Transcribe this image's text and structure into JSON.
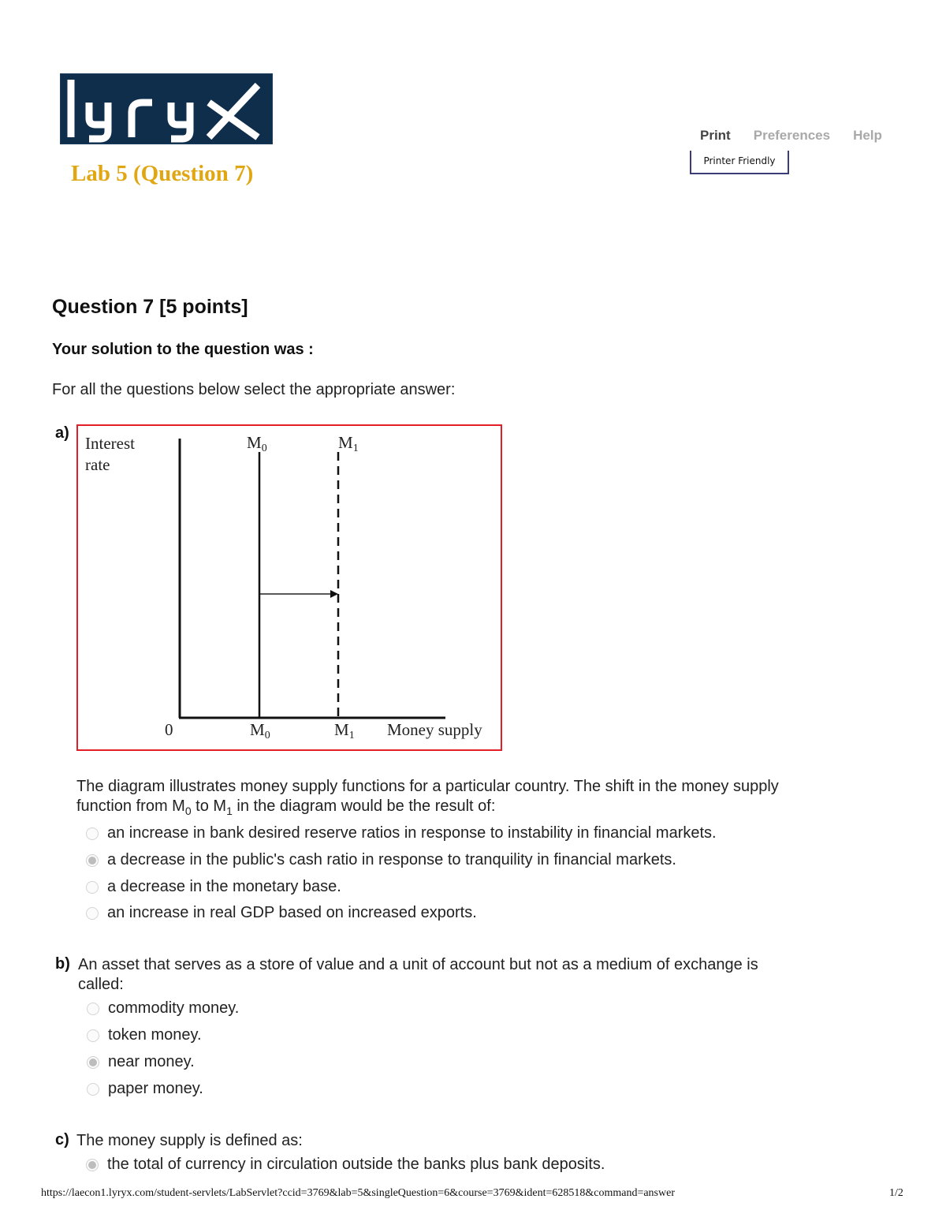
{
  "header": {
    "logo_text": "lyryx",
    "lab_title": "Lab 5 (Question 7)"
  },
  "nav": {
    "items": [
      {
        "label": "Print",
        "state": "active"
      },
      {
        "label": "Preferences",
        "state": "inactive"
      },
      {
        "label": "Help",
        "state": "inactive"
      }
    ],
    "submenu_label": "Printer Friendly"
  },
  "question": {
    "title": "Question 7 [5 points]",
    "solution_label": "Your solution to the question was :",
    "instructions": "For all the questions below select the appropriate answer:"
  },
  "colors": {
    "logo_bg": "#0e2e4b",
    "title_gold": "#e0a712",
    "diagram_border": "#e41e26"
  },
  "diagram": {
    "y_label_line1": "Interest",
    "y_label_line2": "rate",
    "origin_label": "0",
    "x_label": "Money supply",
    "curve_labels": [
      {
        "main": "M",
        "sub": "0",
        "style": "solid"
      },
      {
        "main": "M",
        "sub": "1",
        "style": "dashed"
      }
    ],
    "axis_tick_labels": [
      {
        "main": "M",
        "sub": "0"
      },
      {
        "main": "M",
        "sub": "1"
      }
    ],
    "shift_direction": "right"
  },
  "parts": [
    {
      "label": "a)",
      "text_line1": "The diagram illustrates money supply functions for a particular country. The shift in the money supply",
      "text_line2_pre": "function from M",
      "text_line2_sub0": "0",
      "text_line2_mid": " to M",
      "text_line2_sub1": "1",
      "text_line2_post": " in the diagram would be the result of:",
      "options": [
        {
          "text": "an increase in bank desired reserve ratios in response to instability in financial markets.",
          "selected": false
        },
        {
          "text": "a decrease in the public's cash ratio in response to tranquility in financial markets.",
          "selected": true
        },
        {
          "text": "a decrease in the monetary base.",
          "selected": false
        },
        {
          "text": "an increase in real GDP based on increased exports.",
          "selected": false
        }
      ]
    },
    {
      "label": "b)",
      "text_line1": "An asset that serves as a store of value and a unit of account but not as a medium of exchange is",
      "text_line2": "called:",
      "options": [
        {
          "text": "commodity money.",
          "selected": false
        },
        {
          "text": "token money.",
          "selected": false
        },
        {
          "text": "near money.",
          "selected": true
        },
        {
          "text": "paper money.",
          "selected": false
        }
      ]
    },
    {
      "label": "c)",
      "text_line1": "The money supply is defined as:",
      "options": [
        {
          "text": "the total of currency in circulation outside the banks plus bank deposits.",
          "selected": true
        }
      ]
    }
  ],
  "footer": {
    "url": "https://laecon1.lyryx.com/student-servlets/LabServlet?ccid=3769&lab=5&singleQuestion=6&course=3769&ident=628518&command=answer",
    "page": "1/2"
  }
}
